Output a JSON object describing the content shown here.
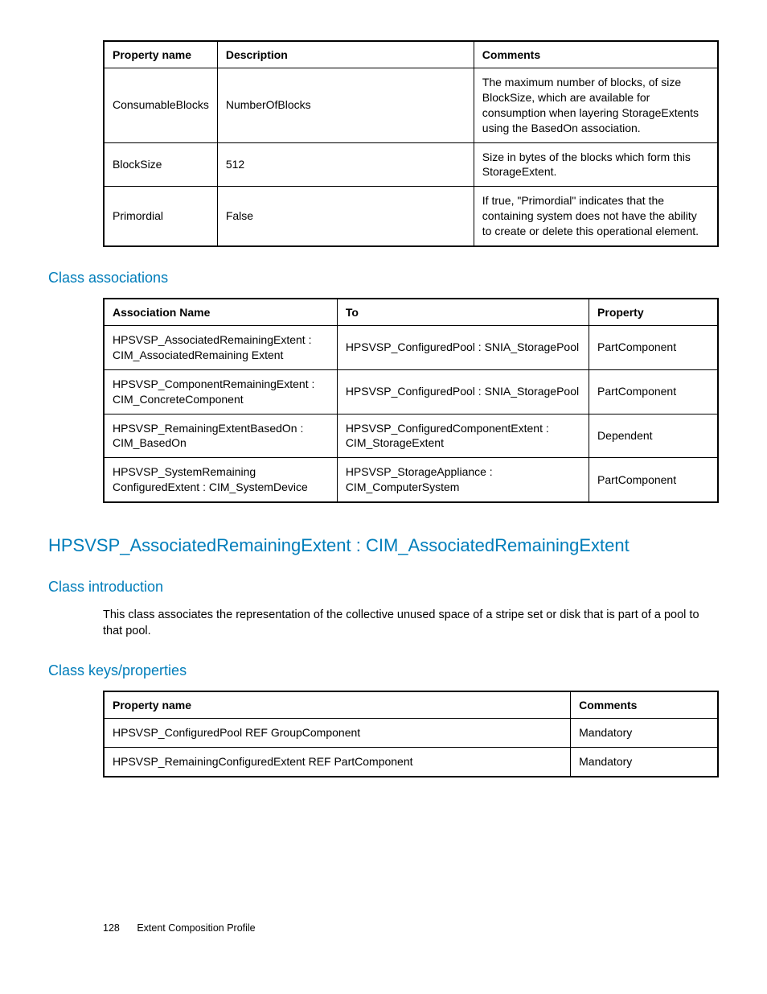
{
  "table1": {
    "headers": {
      "c1": "Property name",
      "c2": "Description",
      "c3": "Comments"
    },
    "rows": [
      {
        "c1": "ConsumableBlocks",
        "c2": "NumberOfBlocks",
        "c3": "The maximum number of blocks, of size BlockSize, which are available for consumption when layering StorageExtents using the BasedOn association."
      },
      {
        "c1": "BlockSize",
        "c2": "512",
        "c3": "Size in bytes of the blocks which form this StorageExtent."
      },
      {
        "c1": "Primordial",
        "c2": "False",
        "c3": "If true, \"Primordial\" indicates that the containing system does not have the ability to create or delete this operational element."
      }
    ]
  },
  "section1_heading": "Class associations",
  "table2": {
    "headers": {
      "c1": "Association Name",
      "c2": "To",
      "c3": "Property"
    },
    "rows": [
      {
        "c1": "HPSVSP_AssociatedRemainingExtent : CIM_AssociatedRemaining Extent",
        "c2": "HPSVSP_ConfiguredPool : SNIA_StoragePool",
        "c3": "PartComponent"
      },
      {
        "c1": "HPSVSP_ComponentRemainingExtent : CIM_ConcreteComponent",
        "c2": "HPSVSP_ConfiguredPool : SNIA_StoragePool",
        "c3": "PartComponent"
      },
      {
        "c1": "HPSVSP_RemainingExtentBasedOn : CIM_BasedOn",
        "c2": "HPSVSP_ConfiguredComponentExtent : CIM_StorageExtent",
        "c3": "Dependent"
      },
      {
        "c1": "HPSVSP_SystemRemaining ConfiguredExtent : CIM_SystemDevice",
        "c2": "HPSVSP_StorageAppliance : CIM_ComputerSystem",
        "c3": "PartComponent"
      }
    ]
  },
  "title_heading": "HPSVSP_AssociatedRemainingExtent : CIM_AssociatedRemainingExtent",
  "section2_heading": "Class introduction",
  "section2_body": "This class associates the representation of the collective unused space of a stripe set or disk that is part of a pool to that pool.",
  "section3_heading": "Class keys/properties",
  "table3": {
    "headers": {
      "c1": "Property name",
      "c2": "Comments"
    },
    "rows": [
      {
        "c1": "HPSVSP_ConfiguredPool REF GroupComponent",
        "c2": "Mandatory"
      },
      {
        "c1": "HPSVSP_RemainingConfiguredExtent REF PartComponent",
        "c2": "Mandatory"
      }
    ]
  },
  "footer": {
    "page": "128",
    "section": "Extent Composition Profile"
  }
}
